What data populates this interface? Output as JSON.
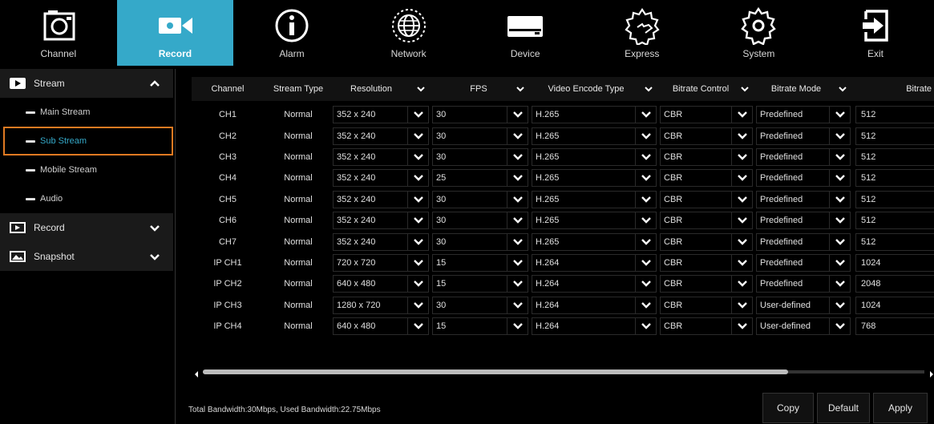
{
  "nav": [
    {
      "label": "Channel",
      "icon": "channel-camera-icon",
      "active": false
    },
    {
      "label": "Record",
      "icon": "record-camera-icon",
      "active": true
    },
    {
      "label": "Alarm",
      "icon": "alarm-info-icon",
      "active": false
    },
    {
      "label": "Network",
      "icon": "network-globe-icon",
      "active": false
    },
    {
      "label": "Device",
      "icon": "device-hdd-icon",
      "active": false
    },
    {
      "label": "Express",
      "icon": "express-gear-hand-icon",
      "active": false
    },
    {
      "label": "System",
      "icon": "system-gear-icon",
      "active": false
    },
    {
      "label": "Exit",
      "icon": "exit-icon",
      "active": false
    }
  ],
  "sidebar": {
    "stream": {
      "label": "Stream",
      "icon": "stream-play-icon",
      "expanded": true
    },
    "items": [
      {
        "label": "Main Stream",
        "active": false
      },
      {
        "label": "Sub Stream",
        "active": true
      },
      {
        "label": "Mobile Stream",
        "active": false
      },
      {
        "label": "Audio",
        "active": false
      }
    ],
    "record": {
      "label": "Record",
      "icon": "record-film-icon"
    },
    "snapshot": {
      "label": "Snapshot",
      "icon": "snapshot-image-icon"
    }
  },
  "table": {
    "headers": [
      "Channel",
      "Stream Type",
      "Resolution",
      "FPS",
      "Video Encode Type",
      "Bitrate Control",
      "Bitrate Mode",
      "Bitrate"
    ],
    "rows": [
      {
        "channel": "CH1",
        "stream_type": "Normal",
        "resolution": "352 x 240",
        "fps": "30",
        "encode": "H.265",
        "control": "CBR",
        "mode": "Predefined",
        "bitrate": "512"
      },
      {
        "channel": "CH2",
        "stream_type": "Normal",
        "resolution": "352 x 240",
        "fps": "30",
        "encode": "H.265",
        "control": "CBR",
        "mode": "Predefined",
        "bitrate": "512"
      },
      {
        "channel": "CH3",
        "stream_type": "Normal",
        "resolution": "352 x 240",
        "fps": "30",
        "encode": "H.265",
        "control": "CBR",
        "mode": "Predefined",
        "bitrate": "512"
      },
      {
        "channel": "CH4",
        "stream_type": "Normal",
        "resolution": "352 x 240",
        "fps": "25",
        "encode": "H.265",
        "control": "CBR",
        "mode": "Predefined",
        "bitrate": "512"
      },
      {
        "channel": "CH5",
        "stream_type": "Normal",
        "resolution": "352 x 240",
        "fps": "30",
        "encode": "H.265",
        "control": "CBR",
        "mode": "Predefined",
        "bitrate": "512"
      },
      {
        "channel": "CH6",
        "stream_type": "Normal",
        "resolution": "352 x 240",
        "fps": "30",
        "encode": "H.265",
        "control": "CBR",
        "mode": "Predefined",
        "bitrate": "512"
      },
      {
        "channel": "CH7",
        "stream_type": "Normal",
        "resolution": "352 x 240",
        "fps": "30",
        "encode": "H.265",
        "control": "CBR",
        "mode": "Predefined",
        "bitrate": "512"
      },
      {
        "channel": "IP CH1",
        "stream_type": "Normal",
        "resolution": "720 x 720",
        "fps": "15",
        "encode": "H.264",
        "control": "CBR",
        "mode": "Predefined",
        "bitrate": "1024"
      },
      {
        "channel": "IP CH2",
        "stream_type": "Normal",
        "resolution": "640 x 480",
        "fps": "15",
        "encode": "H.264",
        "control": "CBR",
        "mode": "Predefined",
        "bitrate": "2048"
      },
      {
        "channel": "IP CH3",
        "stream_type": "Normal",
        "resolution": "1280 x 720",
        "fps": "30",
        "encode": "H.264",
        "control": "CBR",
        "mode": "User-defined",
        "bitrate": "1024"
      },
      {
        "channel": "IP CH4",
        "stream_type": "Normal",
        "resolution": "640 x 480",
        "fps": "15",
        "encode": "H.264",
        "control": "CBR",
        "mode": "User-defined",
        "bitrate": "768"
      }
    ]
  },
  "footer": {
    "bandwidth": "Total Bandwidth:30Mbps, Used Bandwidth:22.75Mbps",
    "copy": "Copy",
    "default": "Default",
    "apply": "Apply"
  },
  "colors": {
    "accent": "#35a9c9",
    "highlight_border": "#e07a22"
  }
}
